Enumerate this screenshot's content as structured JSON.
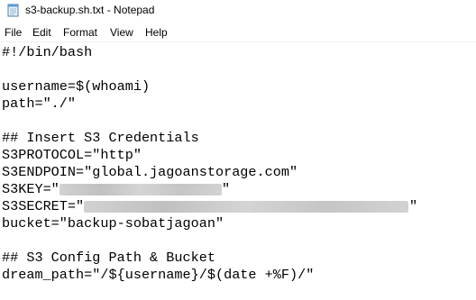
{
  "window": {
    "title": "s3-backup.sh.txt - Notepad",
    "app_icon": "notepad-icon"
  },
  "menu": {
    "file": "File",
    "edit": "Edit",
    "format": "Format",
    "view": "View",
    "help": "Help"
  },
  "editor": {
    "lines": [
      "#!/bin/bash",
      "",
      "username=$(whoami)",
      "path=\"./\"",
      "",
      "## Insert S3 Credentials",
      "S3PROTOCOL=\"http\"",
      "S3ENDPOIN=\"global.jagoanstorage.com\"",
      "S3KEY=\"",
      "S3SECRET=\"",
      "bucket=\"backup-sobatjagoan\"",
      "",
      "## S3 Config Path & Bucket",
      "dream_path=\"/${username}/$(date +%F)/\""
    ],
    "line_9_suffix": "\"",
    "line_10_suffix": "\"",
    "redacted": [
      "S3KEY value",
      "S3SECRET value"
    ]
  }
}
